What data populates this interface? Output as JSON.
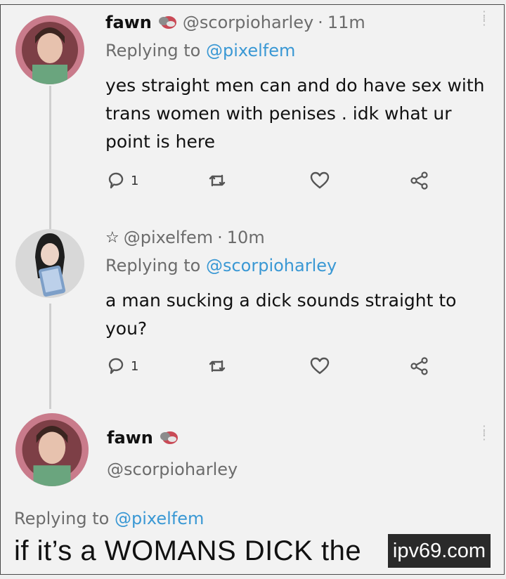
{
  "tweets": [
    {
      "name": "fawn",
      "handle": "@scorpioharley",
      "sep": "·",
      "time": "11m",
      "replying_prefix": "Replying to",
      "replying_to": "@pixelfem",
      "text": "yes straight men can and do have sex with trans women with penises . idk what ur point is here",
      "reply_count": "1"
    },
    {
      "star": "☆",
      "handle": "@pixelfem",
      "sep": "·",
      "time": "10m",
      "replying_prefix": "Replying to",
      "replying_to": "@scorpioharley",
      "text": "a man sucking a dick sounds straight to you?",
      "reply_count": "1"
    }
  ],
  "focused": {
    "name": "fawn",
    "handle": "@scorpioharley",
    "replying_prefix": "Replying to",
    "replying_to": "@pixelfem",
    "text": "if it’s a WOMANS DICK the"
  },
  "watermark": "ipv69.com",
  "colors": {
    "link": "#3a98d4",
    "muted": "#6c6c6c",
    "icon": "#555555",
    "background": "#f2f2f2"
  },
  "icons": [
    "reply-icon",
    "retweet-icon",
    "like-icon",
    "share-icon",
    "more-icon",
    "pill-emoji-icon",
    "star-icon"
  ]
}
